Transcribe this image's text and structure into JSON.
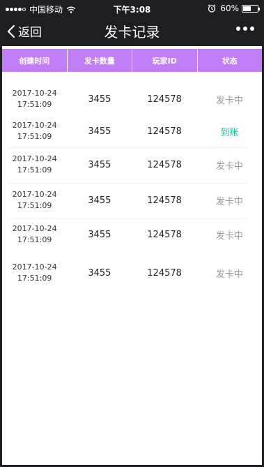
{
  "status_bar": {
    "carrier": "中国移动",
    "time": "下午3:08",
    "battery": "60%",
    "battery_level": 0.6
  },
  "nav": {
    "back_label": "返回",
    "title": "发卡记录"
  },
  "table": {
    "columns": [
      "创建时间",
      "发卡数量",
      "玩家ID",
      "状态"
    ],
    "rows": [
      {
        "date": "2017-10-24",
        "time": "17:51:09",
        "quantity": "3455",
        "player_id": "124578",
        "status": "发卡中",
        "status_color": "#999999"
      },
      {
        "date": "2017-10-24",
        "time": "17:51:09",
        "quantity": "3455",
        "player_id": "124578",
        "status": "到账",
        "status_color": "#1abc9c"
      },
      {
        "date": "2017-10-24",
        "time": "17:51:09",
        "quantity": "3455",
        "player_id": "124578",
        "status": "发卡中",
        "status_color": "#999999"
      },
      {
        "date": "2017-10-24",
        "time": "17:51:09",
        "quantity": "3455",
        "player_id": "124578",
        "status": "发卡中",
        "status_color": "#999999"
      },
      {
        "date": "2017-10-24",
        "time": "17:51:09",
        "quantity": "3455",
        "player_id": "124578",
        "status": "发卡中",
        "status_color": "#999999"
      },
      {
        "date": "2017-10-24",
        "time": "17:51:09",
        "quantity": "3455",
        "player_id": "124578",
        "status": "发卡中",
        "status_color": "#999999"
      }
    ]
  },
  "colors": {
    "header_bg": "#c27ef6",
    "nav_bg": "#1e1e22"
  }
}
